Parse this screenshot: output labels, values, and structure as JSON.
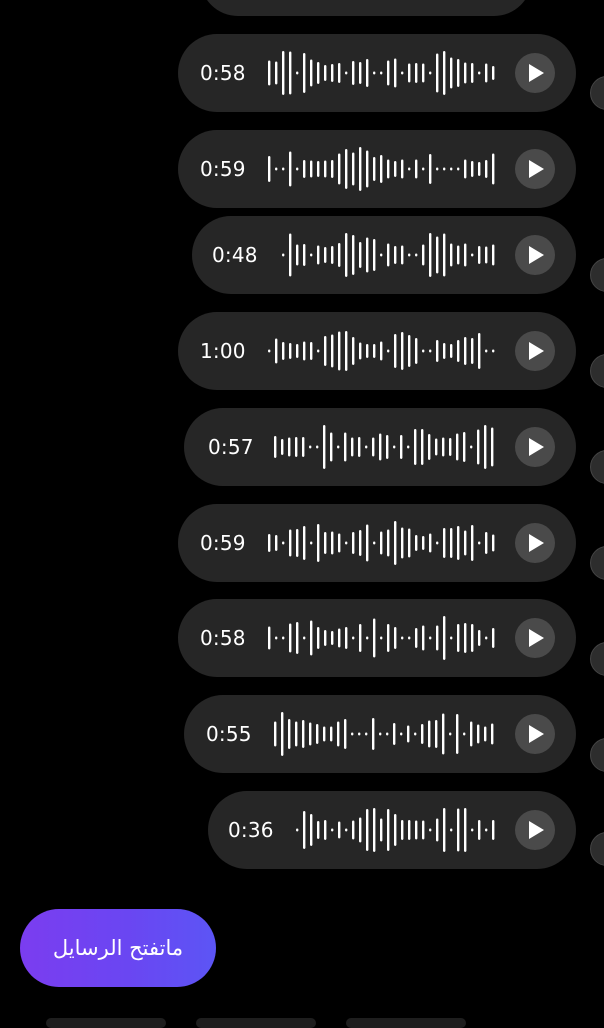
{
  "messages": [
    {
      "duration": "0:58"
    },
    {
      "duration": "0:59"
    },
    {
      "duration": "0:48"
    },
    {
      "duration": "1:00"
    },
    {
      "duration": "0:57"
    },
    {
      "duration": "0:59"
    },
    {
      "duration": "0:58"
    },
    {
      "duration": "0:55"
    },
    {
      "duration": "0:36"
    }
  ],
  "reply_button": {
    "label": "ماتفتح الرسايل"
  },
  "colors": {
    "background": "#000000",
    "bubble": "#262626",
    "play_button": "#4a4a4a",
    "accent_gradient_start": "#7b3df0",
    "accent_gradient_end": "#5c55f5"
  },
  "icons": {
    "play": "play-icon"
  }
}
